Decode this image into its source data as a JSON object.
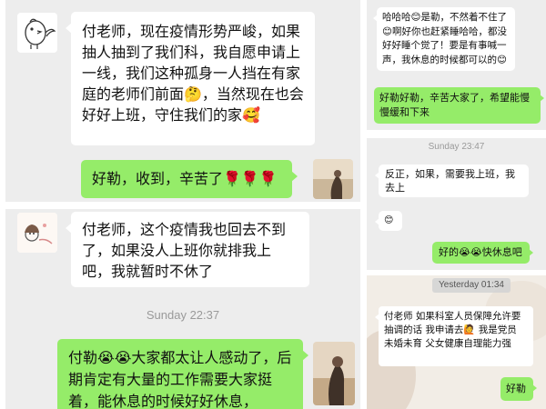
{
  "panel1": {
    "msg1": "付老师，现在疫情形势严峻，如果抽人抽到了我们科，我自愿申请上一线，我们这种孤身一人挡在有家庭的老师们前面🤔，当然现在也会好好上班，守住我们的家🥰",
    "msg2": "好勒，收到，辛苦了🌹🌹🌹"
  },
  "panel2": {
    "msg1": "付老师，这个疫情我也回去不到了，如果没人上班你就排我上吧，我就暂时不休了",
    "timestamp": "Sunday 22:37",
    "msg2": "付勒😭😭大家都太让人感动了，后期肯定有大量的工作需要大家挺着，能休息的时候好好休息，"
  },
  "panel3": {
    "msg1": "哈哈哈😊是勒，不然着不住了😊啊好你也赶紧睡哈哈，都没好好睡个觉了！要是有事喊一声，我休息的时候都可以的😊",
    "msg2": "好勒好勒，辛苦大家了，希望能慢慢缓和下来"
  },
  "panel4": {
    "timestamp": "Sunday 23:47",
    "msg1": "反正，如果，需要我上班，我去上",
    "msg2": "😊",
    "msg3": "好的😭😭快休息吧"
  },
  "panel5": {
    "timestamp": "Yesterday 01:34",
    "msg1": "付老师 如果科室人员保障允许要抽调的话 我申请去🙋 我是党员 未婚未育 父女健康自理能力强",
    "msg2": "好勒"
  },
  "colors": {
    "chat_bg": "#ededed",
    "incoming": "#ffffff",
    "outgoing": "#95ec69",
    "timestamp": "#9a9a9a"
  }
}
